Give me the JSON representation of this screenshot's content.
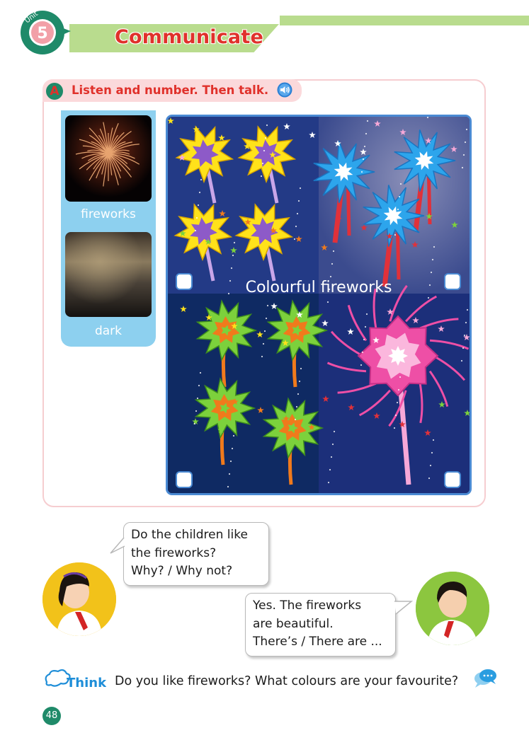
{
  "header": {
    "unit_label": "Unit",
    "unit_number": "5",
    "title": "Communicate"
  },
  "section_a": {
    "badge": "A",
    "instruction": "Listen and number. Then talk.",
    "audio_icon": "speaker-icon",
    "vocabulary": [
      {
        "word": "fireworks",
        "image": "fireworks-photo"
      },
      {
        "word": "dark",
        "image": "dark-sky-photo"
      }
    ],
    "picture_caption": "Colourful fireworks",
    "number_boxes": 4
  },
  "dialogue": {
    "question_lines": [
      "Do the children like",
      "the fireworks?",
      "Why? / Why not?"
    ],
    "answer_lines": [
      "Yes. The fireworks",
      "are beautiful.",
      "There’s / There are ..."
    ]
  },
  "think": {
    "label": "Think",
    "question": "Do you like fireworks? What colours are your favourite?",
    "chat_icon": "chat-bubble-icon"
  },
  "page_number": "48",
  "colors": {
    "title_red": "#e0312b",
    "header_green": "#b9dc8e",
    "badge_teal": "#1f8a69",
    "vocab_panel_blue": "#8dd0ef",
    "picture_border_blue": "#4a8ad3",
    "section_border_pink": "#f6cdd0",
    "night_sky": "#1d2f77"
  }
}
